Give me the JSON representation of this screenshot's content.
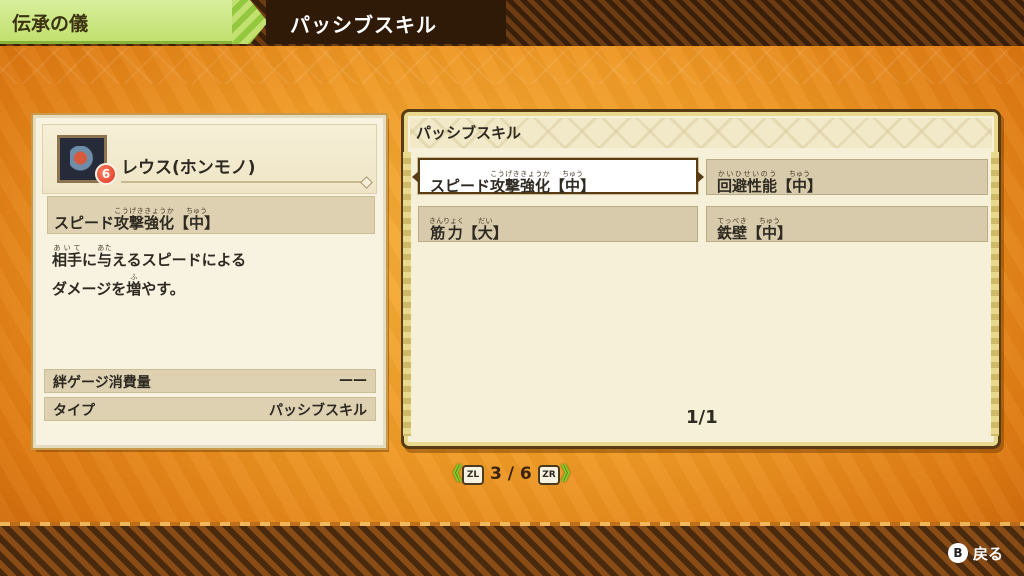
{
  "header": {
    "section": "伝承の儀",
    "title": "パッシブスキル"
  },
  "monster": {
    "name": "レウス(ホンモノ)",
    "badge": "6",
    "icon": "rathalos-icon"
  },
  "selected_skill": {
    "name_prefix": "スピード",
    "name_kanji": "攻撃強化",
    "name_ruby": "こうげききょうか",
    "bracket_open": "【",
    "level": "中",
    "level_ruby": "ちゅう",
    "bracket_close": "】"
  },
  "description": {
    "line1_k1": "相手",
    "line1_k1_ruby": "あいて",
    "line1_p1": "に",
    "line1_k2": "与",
    "line1_k2_ruby": "あた",
    "line1_p2": "えるスピードによる",
    "line2_p1": "ダメージを",
    "line2_k1": "増",
    "line2_k1_ruby": "ふ",
    "line2_p2": "やす。"
  },
  "info": {
    "bond_label": "絆ゲージ消費量",
    "bond_value": "——",
    "type_label": "タイプ",
    "type_value": "パッシブスキル"
  },
  "panel": {
    "title": "パッシブスキル",
    "page": "1/1",
    "skills": [
      {
        "prefix": "スピード",
        "kanji": "攻撃強化",
        "ruby": "こうげききょうか",
        "level": "中",
        "level_ruby": "ちゅう",
        "selected": true
      },
      {
        "prefix": "",
        "kanji": "回避性能",
        "ruby": "かいひせいのう",
        "level": "中",
        "level_ruby": "ちゅう",
        "selected": false
      },
      {
        "prefix": "",
        "kanji": "筋力",
        "ruby": "きんりょく",
        "level": "大",
        "level_ruby": "だい",
        "selected": false
      },
      {
        "prefix": "",
        "kanji": "鉄壁",
        "ruby": "てっぺき",
        "level": "中",
        "level_ruby": "ちゅう",
        "selected": false
      }
    ]
  },
  "pager": {
    "left_key": "ZL",
    "right_key": "ZR",
    "text": "3 / 6",
    "left_arrow": "《",
    "right_arrow": "》"
  },
  "footer": {
    "back_key": "B",
    "back_label": "戻る"
  },
  "colors": {
    "accent_green": "#c2e06f",
    "panel_border": "#5a3c14",
    "background": "#ef9a26"
  }
}
